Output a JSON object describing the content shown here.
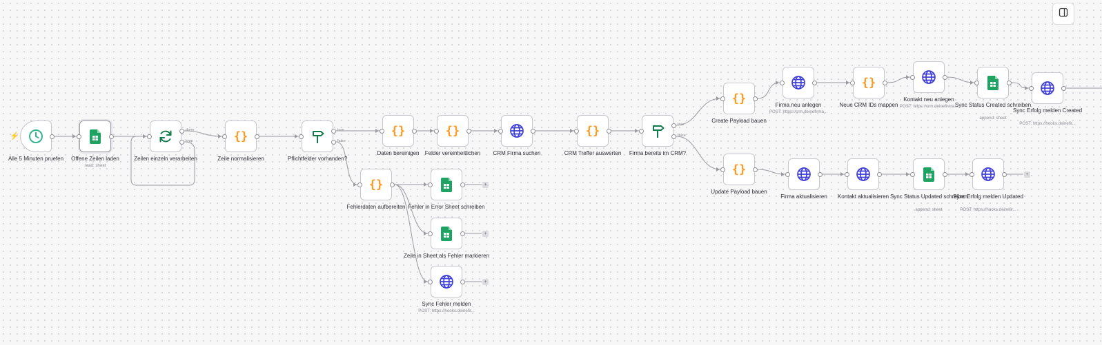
{
  "toolbar": {
    "panel_toggle_icon": "sidebar-panel-icon"
  },
  "colors": {
    "code": "#ff9922",
    "sheets": "#1ea362",
    "http": "#3f3fd9",
    "schedule": "#35b58d",
    "router": "#0f7a4a",
    "trigger_bolt": "#ff6d5a",
    "edge": "#9a9aa0"
  },
  "nodes": [
    {
      "id": "n1",
      "type": "schedule",
      "label": "Alle 5 Minuten pruefen",
      "sub": "",
      "trigger": true
    },
    {
      "id": "n2",
      "type": "sheets",
      "label": "Offene Zeilen laden",
      "sub": "read: sheet",
      "selected": true
    },
    {
      "id": "n3",
      "type": "loop",
      "label": "Zeilen einzeln verarbeiten",
      "sub": "",
      "outputs": [
        "done",
        "loop"
      ]
    },
    {
      "id": "n4",
      "type": "code",
      "label": "Zeile normalisieren",
      "sub": ""
    },
    {
      "id": "n5",
      "type": "if",
      "label": "Pflichtfelder vorhanden?",
      "sub": "",
      "outputs": [
        "true",
        "false"
      ]
    },
    {
      "id": "n6",
      "type": "code",
      "label": "Daten bereinigen",
      "sub": ""
    },
    {
      "id": "n7",
      "type": "code",
      "label": "Felder vereinheitlichen",
      "sub": ""
    },
    {
      "id": "n8",
      "type": "http",
      "label": "CRM Firma suchen",
      "sub": ""
    },
    {
      "id": "n9",
      "type": "code",
      "label": "CRM Treffer auswerten",
      "sub": ""
    },
    {
      "id": "n10",
      "type": "if",
      "label": "Firma bereits im CRM?",
      "sub": "",
      "outputs": [
        "true",
        "false"
      ]
    },
    {
      "id": "n11",
      "type": "code",
      "label": "Create Payload bauen",
      "sub": ""
    },
    {
      "id": "n12",
      "type": "http",
      "label": "Firma neu anlegen",
      "sub": "POST: https://crm.deinefirma..."
    },
    {
      "id": "n13",
      "type": "code",
      "label": "Neue CRM IDs mappen",
      "sub": ""
    },
    {
      "id": "n14",
      "type": "http",
      "label": "Kontakt neu anlegen",
      "sub": "POST: https://crm.deinefirma..."
    },
    {
      "id": "n15",
      "type": "sheets",
      "label": "Sync Status Created schreiben",
      "sub": "append: sheet"
    },
    {
      "id": "n16",
      "type": "http",
      "label": "Sync Erfolg melden Created",
      "sub": "POST: https://hooks.deinefir..."
    },
    {
      "id": "n17",
      "type": "code",
      "label": "Update Payload bauen",
      "sub": ""
    },
    {
      "id": "n18",
      "type": "http",
      "label": "Firma aktualisieren",
      "sub": ""
    },
    {
      "id": "n19",
      "type": "http",
      "label": "Kontakt aktualisieren",
      "sub": ""
    },
    {
      "id": "n20",
      "type": "sheets",
      "label": "Sync Status Updated schreiben",
      "sub": "append: sheet"
    },
    {
      "id": "n21",
      "type": "http",
      "label": "Sync Erfolg melden Updated",
      "sub": "POST: https://hooks.deinefir..."
    },
    {
      "id": "n22",
      "type": "code",
      "label": "Fehlerdaten aufbereiten",
      "sub": ""
    },
    {
      "id": "n23",
      "type": "sheets",
      "label": "Fehler in Error Sheet schreiben",
      "sub": ""
    },
    {
      "id": "n24",
      "type": "sheets",
      "label": "Zeile in Sheet als Fehler markieren",
      "sub": ""
    },
    {
      "id": "n25",
      "type": "http",
      "label": "Sync Fehler melden",
      "sub": "POST: https://hooks.deinefir..."
    }
  ],
  "connections": [
    [
      "n1",
      "n2",
      0
    ],
    [
      "n2",
      "n3",
      0
    ],
    [
      "n3",
      "n4",
      0
    ],
    [
      "n3",
      "n3",
      1
    ],
    [
      "n4",
      "n5",
      0
    ],
    [
      "n5",
      "n6",
      0
    ],
    [
      "n5",
      "n22",
      1
    ],
    [
      "n6",
      "n7",
      0
    ],
    [
      "n7",
      "n8",
      0
    ],
    [
      "n8",
      "n9",
      0
    ],
    [
      "n9",
      "n10",
      0
    ],
    [
      "n10",
      "n11",
      0
    ],
    [
      "n10",
      "n17",
      1
    ],
    [
      "n11",
      "n12",
      0
    ],
    [
      "n12",
      "n13",
      0
    ],
    [
      "n13",
      "n14",
      0
    ],
    [
      "n14",
      "n15",
      0
    ],
    [
      "n15",
      "n16",
      0
    ],
    [
      "n16",
      "out",
      0
    ],
    [
      "n17",
      "n18",
      0
    ],
    [
      "n18",
      "n19",
      0
    ],
    [
      "n19",
      "n20",
      0
    ],
    [
      "n20",
      "n21",
      0
    ],
    [
      "n22",
      "n23",
      0
    ],
    [
      "n22",
      "n24",
      0
    ],
    [
      "n22",
      "n25",
      0
    ]
  ],
  "dangling": [
    "n21",
    "n23",
    "n24",
    "n25"
  ]
}
